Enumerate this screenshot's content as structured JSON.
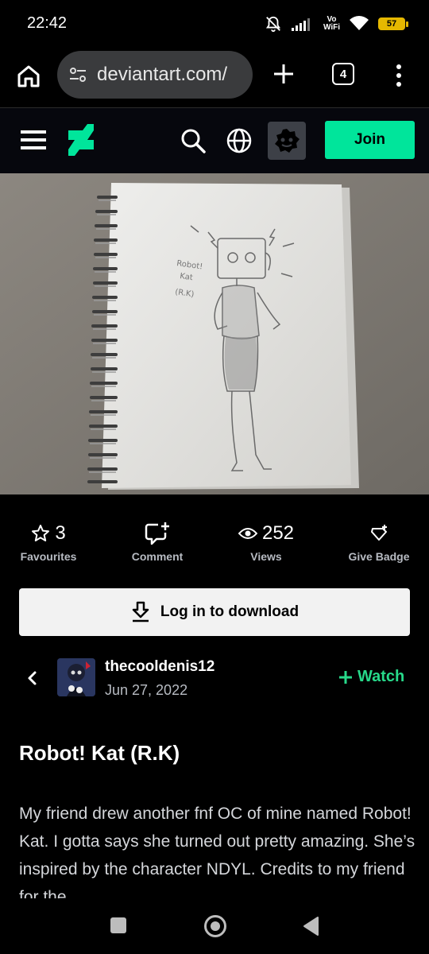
{
  "status_bar": {
    "time": "22:42",
    "vowifi_top": "Vo",
    "vowifi_bottom": "WiFi",
    "battery": "57",
    "icons": [
      "mute-bell-icon",
      "signal-icon",
      "wifi-icon",
      "battery-icon"
    ]
  },
  "browser": {
    "url": "deviantart.com/",
    "tab_count": "4",
    "icons": [
      "home-icon",
      "site-settings-icon",
      "new-tab-plus-icon",
      "tab-switcher-icon",
      "more-vert-icon"
    ]
  },
  "header": {
    "join_label": "Join",
    "icons": [
      "menu-icon",
      "deviantart-logo",
      "search-icon",
      "globe-icon",
      "core-icon"
    ],
    "accent_color": "#00e59b"
  },
  "stats": {
    "favourites_count": "3",
    "favourites_label": "Favourites",
    "comment_label": "Comment",
    "views_count": "252",
    "views_label": "Views",
    "badge_label": "Give Badge"
  },
  "download": {
    "label": "Log in to download"
  },
  "author": {
    "name": "thecooldenis12",
    "date": "Jun 27, 2022",
    "watch_label": "Watch",
    "watch_color": "#27d98a"
  },
  "deviation": {
    "title": "Robot! Kat (R.K)",
    "description": "My friend drew another fnf OC of mine named Robot! Kat. I gotta says she turned out pretty amazing. She’s inspired by the character NDYL. Credits to my friend for the"
  },
  "artwork": {
    "label_line1": "Robot!",
    "label_line2": "Kat",
    "label_line3": "(R.K)"
  }
}
